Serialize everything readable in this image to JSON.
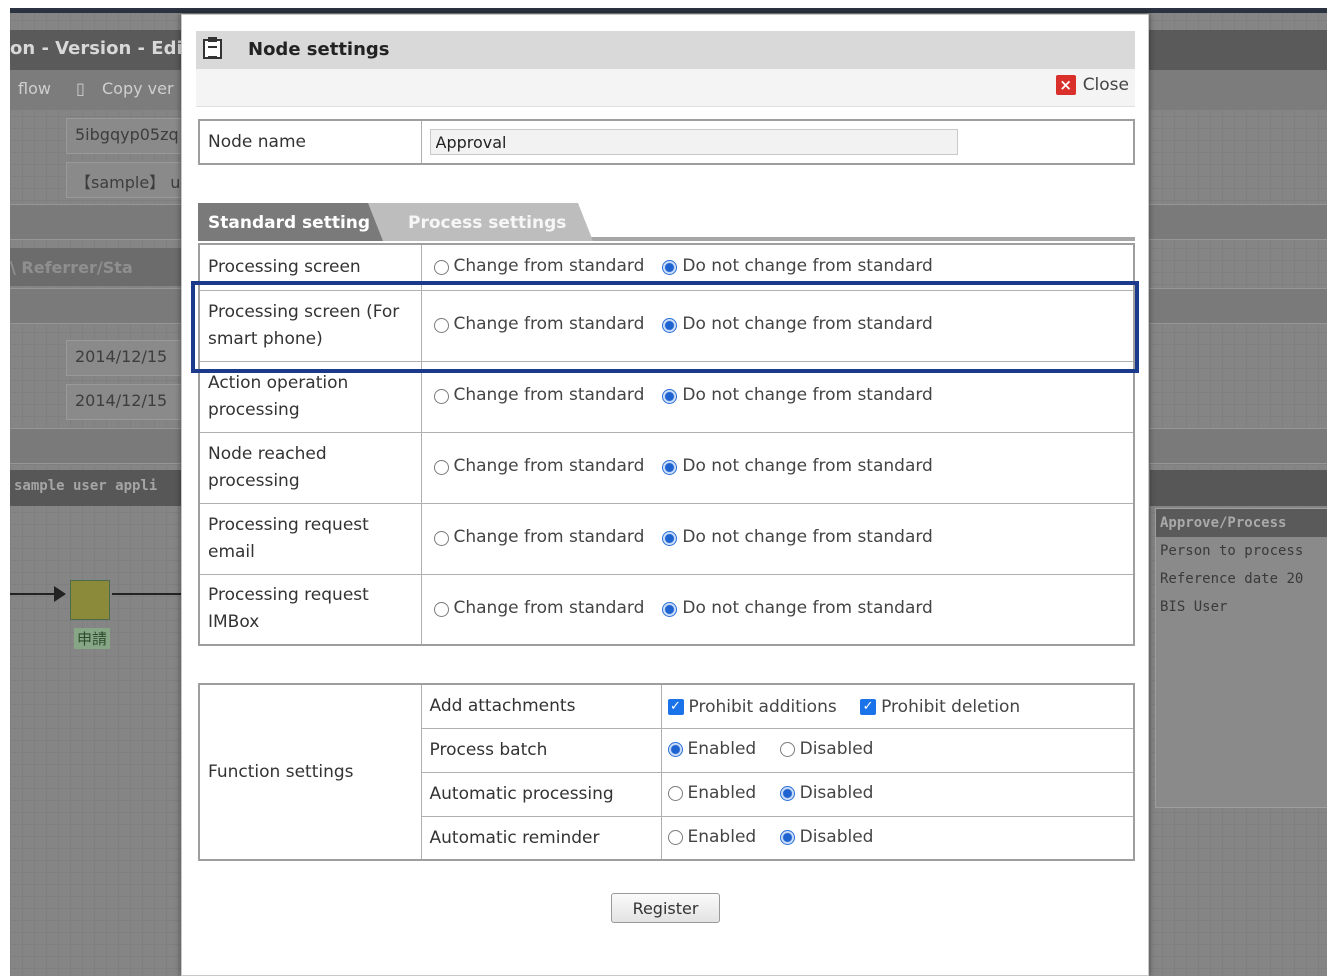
{
  "background": {
    "title_fragment": "on - Version - Edit",
    "toolbar": {
      "flow": "flow",
      "copy": "Copy ver"
    },
    "cells": [
      "5ibgqyp05zq",
      "【sample】 u",
      "2014/12/15",
      "2014/12/15"
    ],
    "tab": "\\ Referrer/Sta",
    "flow_header": "sample user appli",
    "node_label": "申請",
    "right_panel": {
      "title": "Approve/Process",
      "person": "Person to process",
      "reference": "Reference date",
      "reference_value": "20",
      "user": "BIS User"
    }
  },
  "dialog": {
    "title": "Node settings",
    "close_label": "Close",
    "node_name": {
      "label": "Node name",
      "value": "Approval"
    },
    "tabs": [
      {
        "label": "Standard setting",
        "active": true
      },
      {
        "label": "Process settings",
        "active": false
      }
    ],
    "options": {
      "change_label": "Change from standard",
      "keep_label": "Do not change from standard",
      "rows": [
        {
          "label": "Processing screen",
          "selected": "keep"
        },
        {
          "label": "Processing screen (For smart phone)",
          "selected": "keep"
        },
        {
          "label": "Action operation processing",
          "selected": "keep"
        },
        {
          "label": "Node reached processing",
          "selected": "keep"
        },
        {
          "label": "Processing request email",
          "selected": "keep"
        },
        {
          "label": "Processing request IMBox",
          "selected": "keep"
        }
      ]
    },
    "functions": {
      "label": "Function settings",
      "add_attachments": {
        "label": "Add attachments",
        "prohibit_additions": "Prohibit additions",
        "prohibit_deletion": "Prohibit deletion",
        "additions_checked": true,
        "deletion_checked": true
      },
      "process_batch": {
        "label": "Process batch",
        "enabled": "Enabled",
        "disabled": "Disabled",
        "selected": "enabled"
      },
      "automatic_processing": {
        "label": "Automatic processing",
        "enabled": "Enabled",
        "disabled": "Disabled",
        "selected": "disabled"
      },
      "automatic_reminder": {
        "label": "Automatic reminder",
        "enabled": "Enabled",
        "disabled": "Disabled",
        "selected": "disabled"
      }
    },
    "register_label": "Register"
  },
  "colors": {
    "highlight": "#1c3a8b",
    "radio_selected": "#1e63d0",
    "checkbox": "#1a73e8",
    "close_icon": "#d9302c"
  }
}
